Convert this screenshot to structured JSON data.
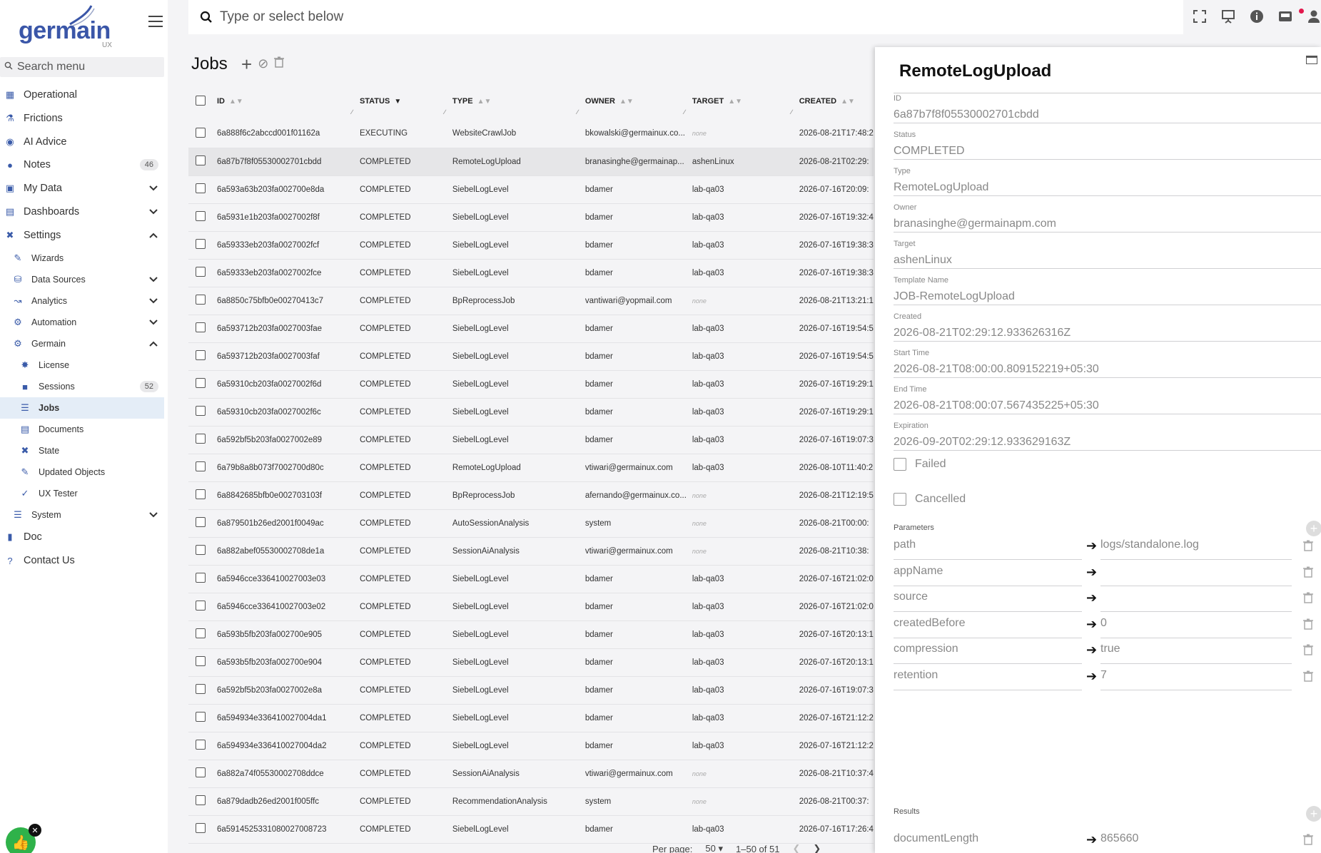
{
  "app": {
    "brand": "germain",
    "brand_suffix": "UX",
    "menu_search_placeholder": "Search menu",
    "top_search_placeholder": "Type or select below"
  },
  "sidebar": {
    "items": [
      {
        "label": "Operational",
        "icon": "sitemap-icon"
      },
      {
        "label": "Frictions",
        "icon": "friction-icon"
      },
      {
        "label": "AI Advice",
        "icon": "brain-icon"
      },
      {
        "label": "Notes",
        "icon": "comment-icon",
        "badge": "46"
      },
      {
        "label": "My Data",
        "icon": "save-icon"
      },
      {
        "label": "Dashboards",
        "icon": "chart-icon"
      },
      {
        "label": "Settings",
        "icon": "tools-icon"
      },
      {
        "label": "Wizards",
        "icon": "wand-icon"
      },
      {
        "label": "Data Sources",
        "icon": "database-icon"
      },
      {
        "label": "Analytics",
        "icon": "analytics-icon"
      },
      {
        "label": "Automation",
        "icon": "robot-icon"
      },
      {
        "label": "Germain",
        "icon": "cogs-icon"
      },
      {
        "label": "License",
        "icon": "certificate-icon"
      },
      {
        "label": "Sessions",
        "icon": "lock-icon",
        "badge": "52"
      },
      {
        "label": "Jobs",
        "icon": "tasks-icon"
      },
      {
        "label": "Documents",
        "icon": "document-icon"
      },
      {
        "label": "State",
        "icon": "state-icon"
      },
      {
        "label": "Updated Objects",
        "icon": "edit-icon"
      },
      {
        "label": "UX Tester",
        "icon": "check-circle-icon"
      },
      {
        "label": "System",
        "icon": "server-icon"
      },
      {
        "label": "Doc",
        "icon": "book-icon"
      },
      {
        "label": "Contact Us",
        "icon": "question-icon"
      }
    ]
  },
  "jobs": {
    "title": "Jobs",
    "columns": [
      "ID",
      "STATUS",
      "TYPE",
      "OWNER",
      "TARGET",
      "CREATED"
    ],
    "rows": [
      [
        "6a888f6c2abccd001f01162a",
        "EXECUTING",
        "WebsiteCrawlJob",
        "bkowalski@germainux.co...",
        "none",
        "2026-08-21T17:48:2"
      ],
      [
        "6a87b7f8f05530002701cbdd",
        "COMPLETED",
        "RemoteLogUpload",
        "branasinghe@germainap...",
        "ashenLinux",
        "2026-08-21T02:29:"
      ],
      [
        "6a593a63b203fa002700e8da",
        "COMPLETED",
        "SiebelLogLevel",
        "bdamer",
        "lab-qa03",
        "2026-07-16T20:09:"
      ],
      [
        "6a5931e1b203fa0027002f8f",
        "COMPLETED",
        "SiebelLogLevel",
        "bdamer",
        "lab-qa03",
        "2026-07-16T19:32:4"
      ],
      [
        "6a59333eb203fa0027002fcf",
        "COMPLETED",
        "SiebelLogLevel",
        "bdamer",
        "lab-qa03",
        "2026-07-16T19:38:3"
      ],
      [
        "6a59333eb203fa0027002fce",
        "COMPLETED",
        "SiebelLogLevel",
        "bdamer",
        "lab-qa03",
        "2026-07-16T19:38:3"
      ],
      [
        "6a8850c75bfb0e00270413c7",
        "COMPLETED",
        "BpReprocessJob",
        "vantiwari@yopmail.com",
        "none",
        "2026-08-21T13:21:1"
      ],
      [
        "6a593712b203fa0027003fae",
        "COMPLETED",
        "SiebelLogLevel",
        "bdamer",
        "lab-qa03",
        "2026-07-16T19:54:5"
      ],
      [
        "6a593712b203fa0027003faf",
        "COMPLETED",
        "SiebelLogLevel",
        "bdamer",
        "lab-qa03",
        "2026-07-16T19:54:5"
      ],
      [
        "6a59310cb203fa0027002f6d",
        "COMPLETED",
        "SiebelLogLevel",
        "bdamer",
        "lab-qa03",
        "2026-07-16T19:29:1"
      ],
      [
        "6a59310cb203fa0027002f6c",
        "COMPLETED",
        "SiebelLogLevel",
        "bdamer",
        "lab-qa03",
        "2026-07-16T19:29:1"
      ],
      [
        "6a592bf5b203fa0027002e89",
        "COMPLETED",
        "SiebelLogLevel",
        "bdamer",
        "lab-qa03",
        "2026-07-16T19:07:3"
      ],
      [
        "6a79b8a8b073f7002700d80c",
        "COMPLETED",
        "RemoteLogUpload",
        "vtiwari@germainux.com",
        "lab-qa03",
        "2026-08-10T11:40:2"
      ],
      [
        "6a8842685bfb0e002703103f",
        "COMPLETED",
        "BpReprocessJob",
        "afernando@germainux.co...",
        "none",
        "2026-08-21T12:19:5"
      ],
      [
        "6a879501b26ed2001f0049ac",
        "COMPLETED",
        "AutoSessionAnalysis",
        "system",
        "none",
        "2026-08-21T00:00:"
      ],
      [
        "6a882abef05530002708de1a",
        "COMPLETED",
        "SessionAiAnalysis",
        "vtiwari@germainux.com",
        "none",
        "2026-08-21T10:38:"
      ],
      [
        "6a5946cce336410027003e03",
        "COMPLETED",
        "SiebelLogLevel",
        "bdamer",
        "lab-qa03",
        "2026-07-16T21:02:0"
      ],
      [
        "6a5946cce336410027003e02",
        "COMPLETED",
        "SiebelLogLevel",
        "bdamer",
        "lab-qa03",
        "2026-07-16T21:02:0"
      ],
      [
        "6a593b5fb203fa002700e905",
        "COMPLETED",
        "SiebelLogLevel",
        "bdamer",
        "lab-qa03",
        "2026-07-16T20:13:1"
      ],
      [
        "6a593b5fb203fa002700e904",
        "COMPLETED",
        "SiebelLogLevel",
        "bdamer",
        "lab-qa03",
        "2026-07-16T20:13:1"
      ],
      [
        "6a592bf5b203fa0027002e8a",
        "COMPLETED",
        "SiebelLogLevel",
        "bdamer",
        "lab-qa03",
        "2026-07-16T19:07:3"
      ],
      [
        "6a594934e336410027004da1",
        "COMPLETED",
        "SiebelLogLevel",
        "bdamer",
        "lab-qa03",
        "2026-07-16T21:12:2"
      ],
      [
        "6a594934e336410027004da2",
        "COMPLETED",
        "SiebelLogLevel",
        "bdamer",
        "lab-qa03",
        "2026-07-16T21:12:2"
      ],
      [
        "6a882a74f05530002708ddce",
        "COMPLETED",
        "SessionAiAnalysis",
        "vtiwari@germainux.com",
        "none",
        "2026-08-21T10:37:4"
      ],
      [
        "6a879dadb26ed2001f005ffc",
        "COMPLETED",
        "RecommendationAnalysis",
        "system",
        "none",
        "2026-08-21T00:37:"
      ],
      [
        "6a5914525331080027008723",
        "COMPLETED",
        "SiebelLogLevel",
        "bdamer",
        "lab-qa03",
        "2026-07-16T17:26:4"
      ]
    ],
    "selected_row": 1,
    "pager": {
      "per_page_label": "Per page:",
      "per_page": "50",
      "range": "1–50 of 51"
    }
  },
  "detail": {
    "title": "RemoteLogUpload",
    "fields": [
      {
        "label": "ID",
        "value": "6a87b7f8f05530002701cbdd"
      },
      {
        "label": "Status",
        "value": "COMPLETED"
      },
      {
        "label": "Type",
        "value": "RemoteLogUpload"
      },
      {
        "label": "Owner",
        "value": "branasinghe@germainapm.com"
      },
      {
        "label": "Target",
        "value": "ashenLinux"
      },
      {
        "label": "Template Name",
        "value": "JOB-RemoteLogUpload"
      },
      {
        "label": "Created",
        "value": "2026-08-21T02:29:12.933626316Z"
      },
      {
        "label": "Start Time",
        "value": "2026-08-21T08:00:00.809152219+05:30"
      },
      {
        "label": "End Time",
        "value": "2026-08-21T08:00:07.567435225+05:30"
      },
      {
        "label": "Expiration",
        "value": "2026-09-20T02:29:12.933629163Z"
      }
    ],
    "failed_label": "Failed",
    "cancelled_label": "Cancelled",
    "parameters_label": "Parameters",
    "parameters": [
      {
        "key": "path",
        "value": "logs/standalone.log"
      },
      {
        "key": "appName",
        "value": ""
      },
      {
        "key": "source",
        "value": ""
      },
      {
        "key": "createdBefore",
        "value": "0"
      },
      {
        "key": "compression",
        "value": "true"
      },
      {
        "key": "retention",
        "value": "7"
      }
    ],
    "results_label": "Results",
    "results": [
      {
        "key": "documentLength",
        "value": "865660"
      }
    ]
  }
}
